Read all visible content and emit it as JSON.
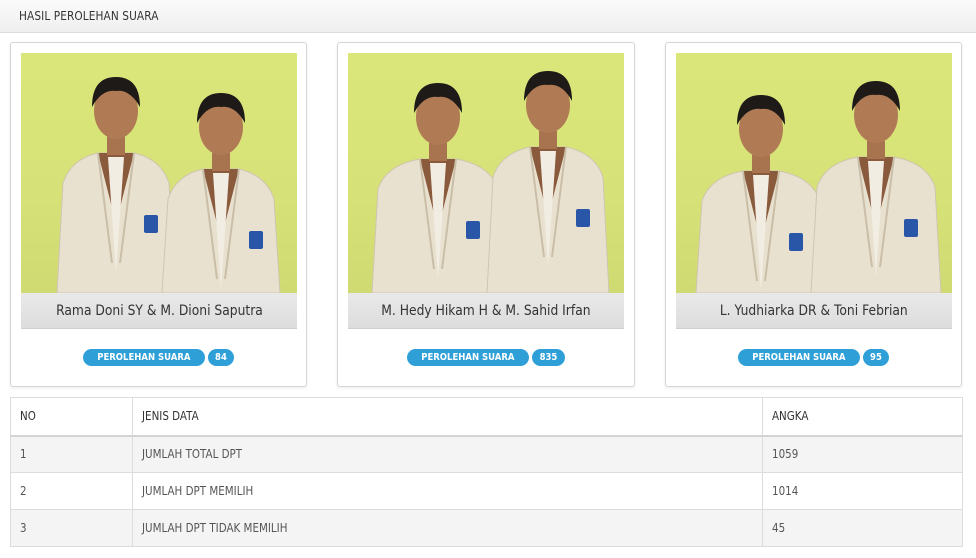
{
  "header": {
    "title": "HASIL PEROLEHAN SUARA"
  },
  "candidates": [
    {
      "name": "Rama Doni SY & M. Dioni Saputra",
      "votes_label": "PEROLEHAN SUARA",
      "votes": "84"
    },
    {
      "name": "M. Hedy Hikam H & M. Sahid Irfan",
      "votes_label": "PEROLEHAN SUARA",
      "votes": "835"
    },
    {
      "name": "L. Yudhiarka DR & Toni Febrian",
      "votes_label": "PEROLEHAN SUARA",
      "votes": "95"
    }
  ],
  "table": {
    "headers": [
      "NO",
      "JENIS DATA",
      "ANGKA"
    ],
    "rows": [
      [
        "1",
        "JUMLAH TOTAL DPT",
        "1059"
      ],
      [
        "2",
        "JUMLAH DPT MEMILIH",
        "1014"
      ],
      [
        "3",
        "JUMLAH DPT TIDAK MEMILIH",
        "45"
      ]
    ]
  },
  "colors": {
    "badge": "#2f9fd8",
    "photo_background": "#d6e277",
    "jacket": "#e9e1d0"
  }
}
